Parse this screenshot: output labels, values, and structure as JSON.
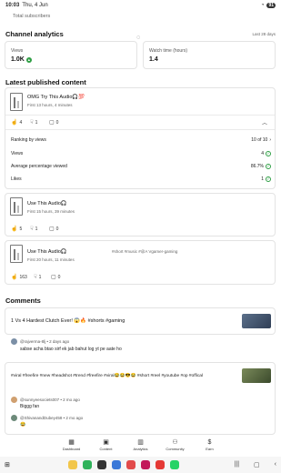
{
  "status_bar": {
    "time": "10:03",
    "date": "Thu, 4 Jun",
    "battery": "91"
  },
  "channel": {
    "subscribers_label": "Total subscribers"
  },
  "analytics": {
    "title": "Channel analytics",
    "period": "Last 28 days",
    "views_label": "Views",
    "views_value": "1.0K",
    "watch_time_label": "Watch time (hours)",
    "watch_time_value": "1.4"
  },
  "latest": {
    "title": "Latest published content",
    "videos": [
      {
        "title": "OMG Try This Audio🎧💯",
        "time": "First 13 hours, 4 minutes",
        "likes": "4",
        "dislikes": "1",
        "comments": "0"
      },
      {
        "title": "Use This Audio🎧",
        "time": "First 15 hours, 39 minutes",
        "likes": "5",
        "dislikes": "1",
        "comments": "0"
      },
      {
        "title": "Use This Audio🎧",
        "tags": "#short #music #@A Vgamer-gaming",
        "time": "First 20 hours, 11 minutes",
        "likes": "163",
        "dislikes": "1",
        "comments": "0"
      }
    ],
    "ranking": {
      "rank_label": "Ranking by views",
      "rank_value": "10 of 10",
      "views_label": "Views",
      "views_value": "4",
      "avg_label": "Average percentage viewed",
      "avg_value": "86.7%",
      "likes_label": "Likes",
      "likes_value": "1"
    }
  },
  "comments": {
    "title": "Comments",
    "threads": [
      {
        "video": "1 Vs 4 Hardest Clutch Ever! 😱🔥 #shorts #gaming",
        "items": [
          {
            "user": "@rajverma-8lj • 2 days ago",
            "text": "sabse acha btao sirf ek jab bahut log yt pe aate ho"
          }
        ]
      },
      {
        "video": "#viral #freefire #new #headshot #trend #freefire #viral😂😂😎😂 #short #reel #youtube #op #offical",
        "items": [
          {
            "user": "@sunnyeesociets007 • 2 mo ago",
            "text": "Biggg fan"
          },
          {
            "user": "@ShivanandDubey458 • 2 mo ago",
            "text": "😂"
          }
        ]
      }
    ]
  },
  "nav": {
    "items": [
      {
        "icon": "dashboard-icon",
        "glyph": "▦",
        "label": "Dashboard"
      },
      {
        "icon": "content-icon",
        "glyph": "▣",
        "label": "Content"
      },
      {
        "icon": "analytics-icon",
        "glyph": "▥",
        "label": "Analytics"
      },
      {
        "icon": "community-icon",
        "glyph": "⚇",
        "label": "Community"
      },
      {
        "icon": "earn-icon",
        "glyph": "$",
        "label": "Earn"
      }
    ]
  },
  "colors": {
    "green": "#2e9e44"
  }
}
